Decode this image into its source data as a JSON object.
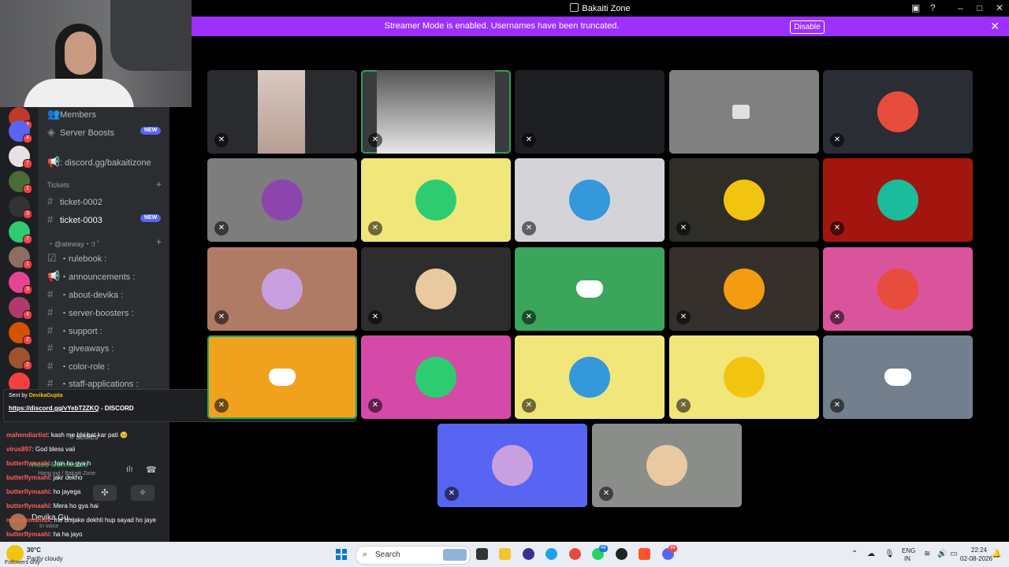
{
  "window": {
    "title": "Bakaiti Zone"
  },
  "banner": {
    "message": "Streamer Mode is enabled. Usernames have been truncated.",
    "disable_label": "Disable"
  },
  "sidebar": {
    "items": [
      {
        "label": "Members"
      },
      {
        "label": "Server Boosts",
        "badge": "NEW"
      },
      {
        "label": ": discord.gg/bakaitizone"
      }
    ],
    "categories": [
      {
        "label": "Tickets"
      },
      {
        "label": "・@ateway・؛l ˚"
      }
    ],
    "channels": [
      {
        "label": "ticket-0002"
      },
      {
        "label": "ticket-0003",
        "badge": "NEW"
      },
      {
        "label": "・rulebook :"
      },
      {
        "label": "・announcements :"
      },
      {
        "label": "・about-devika :"
      },
      {
        "label": "・server-boosters :"
      },
      {
        "label": "・support :"
      },
      {
        "label": "・giveaways :"
      },
      {
        "label": "・color-role :"
      },
      {
        "label": "・staff-applications :"
      },
      {
        "label": "selfies"
      }
    ],
    "server_badges": [
      "4",
      "4",
      "7",
      "1",
      "3",
      "2",
      "1",
      "3",
      "4",
      "2",
      "2"
    ]
  },
  "voice_panel": {
    "label": "Video Connected",
    "sub": "Hang out / Bakaiti Zone",
    "user": "Devika Gu...",
    "status": "In voice"
  },
  "chat": {
    "pinned_sender_prefix": "Sent by",
    "pinned_sender": "DevikaGupta",
    "pinned_link": "https://discord.gg/vYebT2ZKQ",
    "pinned_suffix": "- DISCORD",
    "messages": [
      {
        "user": "mahendiartist",
        "text": "kash me bhi bat kar pati 😣"
      },
      {
        "user": "virus897",
        "text": "God bless vaii"
      },
      {
        "user": "butterflymaahi",
        "text": "Join ho gya h"
      },
      {
        "user": "butterflymaahi",
        "text": "jakr dekho"
      },
      {
        "user": "butterflymaahi",
        "text": "ho jayega"
      },
      {
        "user": "butterflymaahi",
        "text": "Mera ho gya hai"
      },
      {
        "user": "monstemaniax",
        "text": "me bhijake dekhti hup sayad ho jaye"
      },
      {
        "user": "butterflymaahi",
        "text": "ha ha jayo"
      }
    ]
  },
  "tiles": [
    {
      "bg": "#2a2b2e",
      "kind": "cam"
    },
    {
      "bg": "#3a3b3d",
      "kind": "cam"
    },
    {
      "bg": "#1e1f22",
      "kind": "dark"
    },
    {
      "bg": "#808080",
      "kind": "camera-off"
    },
    {
      "bg": "#2b2d35",
      "kind": "avatar"
    },
    {
      "bg": "#7d7d7d",
      "kind": "avatar"
    },
    {
      "bg": "#f0e67a",
      "kind": "avatar"
    },
    {
      "bg": "#d4d4d8",
      "kind": "avatar"
    },
    {
      "bg": "#2e2d28",
      "kind": "avatar"
    },
    {
      "bg": "#a3160f",
      "kind": "avatar"
    },
    {
      "bg": "#b07b64",
      "kind": "avatar"
    },
    {
      "bg": "#2d2d2d",
      "kind": "avatar"
    },
    {
      "bg": "#3ba55c",
      "kind": "discord"
    },
    {
      "bg": "#35302c",
      "kind": "avatar"
    },
    {
      "bg": "#d9549a",
      "kind": "avatar"
    },
    {
      "bg": "#f0a21f",
      "kind": "discord"
    },
    {
      "bg": "#d54aa6",
      "kind": "avatar"
    },
    {
      "bg": "#f0e67a",
      "kind": "avatar"
    },
    {
      "bg": "#f0e67a",
      "kind": "avatar"
    },
    {
      "bg": "#747f8d",
      "kind": "discord"
    },
    {
      "bg": "#5865f2",
      "kind": "avatar"
    },
    {
      "bg": "#8a8d89",
      "kind": "avatar"
    }
  ],
  "taskbar": {
    "search_label": "Search",
    "weather_temp": "30°C",
    "weather_text": "Partly cloudy",
    "lang": "ENG",
    "region": "IN",
    "time": "22:24",
    "date": "02-08-2026",
    "badge_whatsapp": "46",
    "badge_discord": "99"
  },
  "overlay_text": {
    "followers": "Followers only"
  }
}
